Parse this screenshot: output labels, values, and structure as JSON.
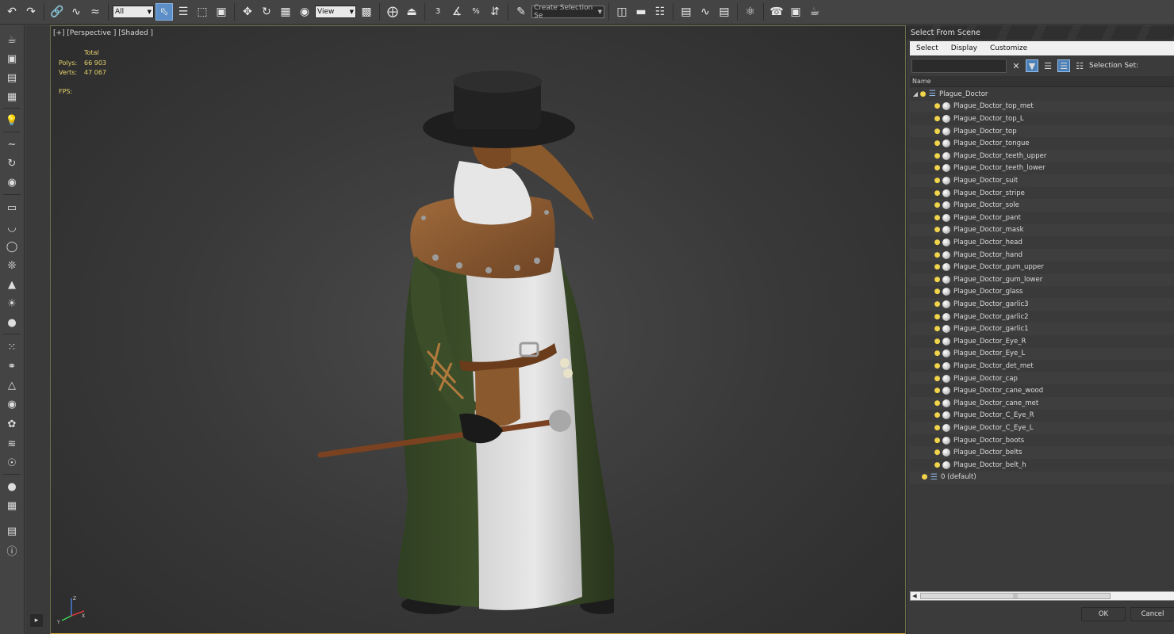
{
  "toolbar": {
    "filter_value": "All",
    "ref_coord_value": "View",
    "snap_labels": [
      "3",
      "°",
      "%",
      "n"
    ],
    "selection_set_placeholder": "Create Selection Se",
    "icons": [
      "undo-icon",
      "redo-icon",
      "link-icon",
      "unlink-icon",
      "bind-spacewarp-icon",
      "select-object-icon",
      "select-by-name-icon",
      "rect-select-region-icon",
      "window-crossing-icon",
      "move-icon",
      "rotate-icon",
      "scale-icon",
      "place-icon",
      "use-pivot-icon",
      "keyboard-shortcut-icon",
      "snap-toggle-icon",
      "angle-snap-icon",
      "percent-snap-icon",
      "spinner-snap-icon",
      "edit-named-sel-icon",
      "mirror-icon",
      "align-icon",
      "scene-explorer-icon",
      "layer-explorer-icon",
      "ribbon-icon",
      "curve-editor-icon",
      "schematic-view-icon",
      "material-editor-icon",
      "render-setup-icon",
      "rendered-frame-icon",
      "render-icon"
    ]
  },
  "leftbar": {
    "icons": [
      "teapot-icon",
      "render-icon",
      "frame-icon",
      "grid-icon",
      "light-icon",
      "move-sub-icon",
      "rotate-sub-icon",
      "scale-sub-icon",
      "plane-icon",
      "half-sphere-icon",
      "sphere-icon",
      "grass-icon",
      "cone-icon",
      "sun-icon",
      "disc-icon",
      "particles-icon",
      "molecule-icon",
      "mesh-icon",
      "globe-icon",
      "plant-icon",
      "hf-icon",
      "of-icon",
      "ball-icon",
      "table-icon",
      "clipboard-icon",
      "help-icon"
    ],
    "expand_arrow": "▸"
  },
  "viewport": {
    "label": "[+] [Perspective ] [Shaded ]",
    "stats_header": "Total",
    "stats": [
      {
        "label": "Polys:",
        "value": "66 903"
      },
      {
        "label": "Verts:",
        "value": "47 067"
      }
    ],
    "fps_label": "FPS:",
    "axis_labels": [
      "Z",
      "X",
      "Y"
    ],
    "colors": {
      "border": "#c9a23c",
      "stats": "#e6d36a"
    }
  },
  "panel": {
    "title": "Select From Scene",
    "menu": [
      "Select",
      "Display",
      "Customize"
    ],
    "search_placeholder": "",
    "clear_glyph": "✕",
    "selection_set_label": "Selection Set:",
    "column_header": "Name",
    "root_layer": "Plague_Doctor",
    "objects": [
      "Plague_Doctor_top_met",
      "Plague_Doctor_top_L",
      "Plague_Doctor_top",
      "Plague_Doctor_tongue",
      "Plague_Doctor_teeth_upper",
      "Plague_Doctor_teeth_lower",
      "Plague_Doctor_suit",
      "Plague_Doctor_stripe",
      "Plague_Doctor_sole",
      "Plague_Doctor_pant",
      "Plague_Doctor_mask",
      "Plague_Doctor_head",
      "Plague_Doctor_hand",
      "Plague_Doctor_gum_upper",
      "Plague_Doctor_gum_lower",
      "Plague_Doctor_glass",
      "Plague_Doctor_garlic3",
      "Plague_Doctor_garlic2",
      "Plague_Doctor_garlic1",
      "Plague_Doctor_Eye_R",
      "Plague_Doctor_Eye_L",
      "Plague_Doctor_det_met",
      "Plague_Doctor_cap",
      "Plague_Doctor_cane_wood",
      "Plague_Doctor_cane_met",
      "Plague_Doctor_C_Eye_R",
      "Plague_Doctor_C_Eye_L",
      "Plague_Doctor_boots",
      "Plague_Doctor_belts",
      "Plague_Doctor_belt_h"
    ],
    "default_layer": "0 (default)",
    "ok_label": "OK",
    "cancel_label": "Cancel",
    "scroll_grip": "|||",
    "colors": {
      "active_icon": "#4a7fb7",
      "bulb": "#f1d44a"
    }
  }
}
